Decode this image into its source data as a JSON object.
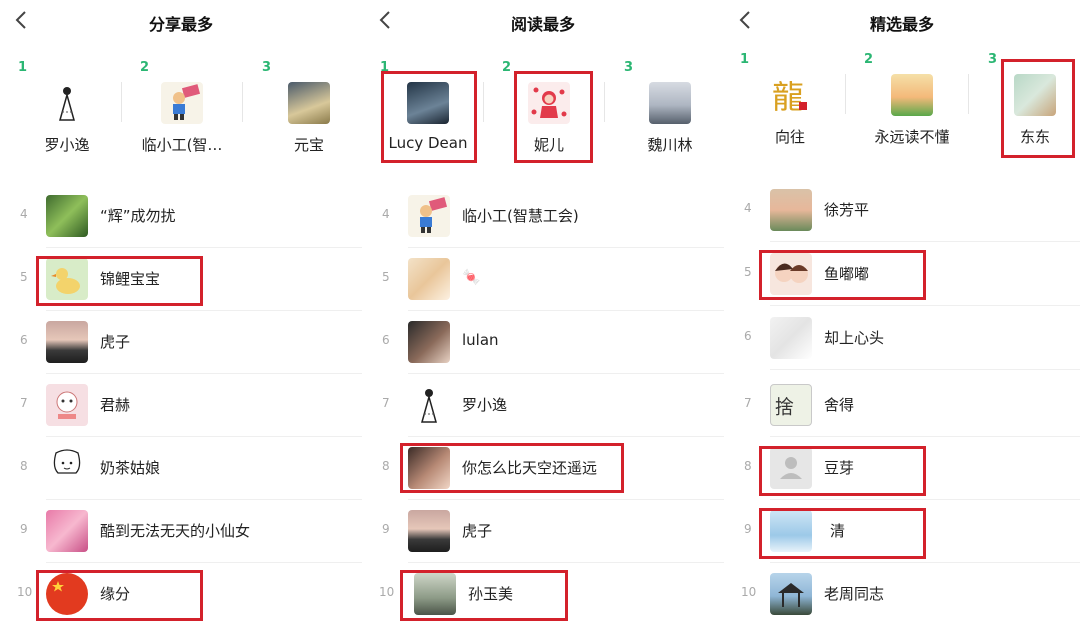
{
  "colors": {
    "rank_top": "#2bb673",
    "highlight": "#d3212b"
  },
  "panels": [
    {
      "title": "分享最多",
      "top": [
        {
          "rank": "1",
          "name": "罗小逸"
        },
        {
          "rank": "2",
          "name": "临小工(智…"
        },
        {
          "rank": "3",
          "name": "元宝"
        }
      ],
      "list": [
        {
          "rank": "4",
          "name": "“辉”成勿扰"
        },
        {
          "rank": "5",
          "name": "锦鲤宝宝"
        },
        {
          "rank": "6",
          "name": "虎子"
        },
        {
          "rank": "7",
          "name": "君赫"
        },
        {
          "rank": "8",
          "name": "奶茶姑娘"
        },
        {
          "rank": "9",
          "name": "酷到无法无天的小仙女"
        },
        {
          "rank": "10",
          "name": "缘分"
        }
      ]
    },
    {
      "title": "阅读最多",
      "top": [
        {
          "rank": "1",
          "name": "Lucy Dean"
        },
        {
          "rank": "2",
          "name": "妮儿"
        },
        {
          "rank": "3",
          "name": "魏川林"
        }
      ],
      "list": [
        {
          "rank": "4",
          "name": "临小工(智慧工会)"
        },
        {
          "rank": "5",
          "name": "🍬"
        },
        {
          "rank": "6",
          "name": "lulan"
        },
        {
          "rank": "7",
          "name": "罗小逸"
        },
        {
          "rank": "8",
          "name": "你怎么比天空还遥远"
        },
        {
          "rank": "9",
          "name": "虎子"
        },
        {
          "rank": "10",
          "name": "孙玉美"
        }
      ]
    },
    {
      "title": "精选最多",
      "top": [
        {
          "rank": "1",
          "name": "向往"
        },
        {
          "rank": "2",
          "name": "永远读不懂"
        },
        {
          "rank": "3",
          "name": "东东"
        }
      ],
      "list": [
        {
          "rank": "4",
          "name": "徐芳平"
        },
        {
          "rank": "5",
          "name": "鱼嘟嘟"
        },
        {
          "rank": "6",
          "name": "却上心头"
        },
        {
          "rank": "7",
          "name": "舍得"
        },
        {
          "rank": "8",
          "name": "豆芽"
        },
        {
          "rank": "9",
          "name": "清"
        },
        {
          "rank": "10",
          "name": "老周同志"
        }
      ]
    }
  ]
}
